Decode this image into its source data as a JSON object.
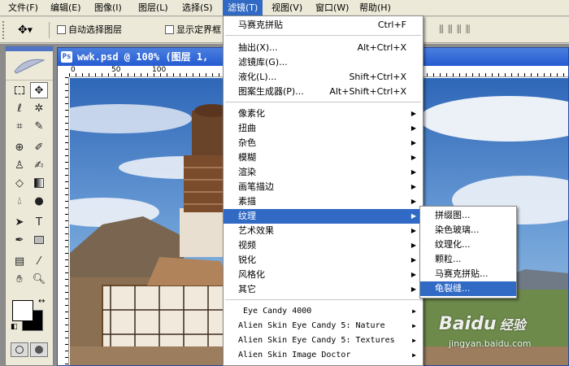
{
  "menubar": {
    "items": [
      {
        "label": "文件(F)"
      },
      {
        "label": "编辑(E)"
      },
      {
        "label": "图像(I)"
      },
      {
        "label": "图层(L)"
      },
      {
        "label": "选择(S)"
      },
      {
        "label": "滤镜(T)",
        "active": true
      },
      {
        "label": "视图(V)"
      },
      {
        "label": "窗口(W)"
      },
      {
        "label": "帮助(H)"
      }
    ]
  },
  "options_bar": {
    "auto_select_label": "自动选择图层",
    "show_bounds_label": "显示定界框"
  },
  "document": {
    "title": "wwk.psd @ 100% (图层 1,",
    "ruler_numbers": [
      "0",
      "50",
      "100"
    ]
  },
  "filter_menu": {
    "last_filter": {
      "label": "马赛克拼贴",
      "shortcut": "Ctrl+F"
    },
    "group1": [
      {
        "label": "抽出(X)...",
        "shortcut": "Alt+Ctrl+X"
      },
      {
        "label": "滤镜库(G)...",
        "shortcut": ""
      },
      {
        "label": "液化(L)...",
        "shortcut": "Shift+Ctrl+X"
      },
      {
        "label": "图案生成器(P)...",
        "shortcut": "Alt+Shift+Ctrl+X"
      }
    ],
    "group2": [
      {
        "label": "像素化"
      },
      {
        "label": "扭曲"
      },
      {
        "label": "杂色"
      },
      {
        "label": "模糊"
      },
      {
        "label": "渲染"
      },
      {
        "label": "画笔描边"
      },
      {
        "label": "素描"
      },
      {
        "label": "纹理",
        "highlighted": true
      },
      {
        "label": "艺术效果"
      },
      {
        "label": "视频"
      },
      {
        "label": "锐化"
      },
      {
        "label": "风格化"
      },
      {
        "label": "其它"
      }
    ],
    "group3": [
      {
        "label": "Eye Candy 4000"
      },
      {
        "label": "Alien Skin Eye Candy 5: Nature"
      },
      {
        "label": "Alien Skin Eye Candy 5: Textures"
      },
      {
        "label": "Alien Skin Image Doctor"
      }
    ]
  },
  "texture_submenu": {
    "items": [
      {
        "label": "拼缀图..."
      },
      {
        "label": "染色玻璃..."
      },
      {
        "label": "纹理化..."
      },
      {
        "label": "颗粒..."
      },
      {
        "label": "马赛克拼贴..."
      },
      {
        "label": "龟裂缝...",
        "highlighted": true
      }
    ]
  },
  "watermark": {
    "brand": "Baidu",
    "brand_cn": "经验",
    "url": "jingyan.baidu.com"
  },
  "colors": {
    "highlight": "#316ac5",
    "title_bar": "#245bd0"
  }
}
